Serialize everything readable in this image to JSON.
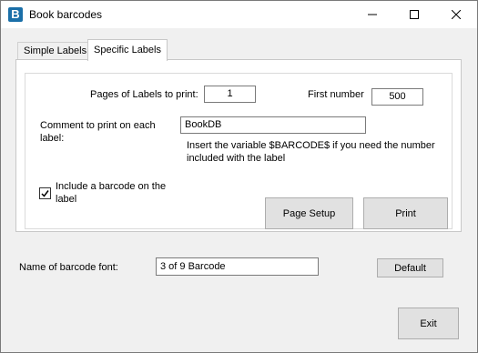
{
  "window": {
    "title": "Book barcodes",
    "app_icon_letter": "B"
  },
  "tabs": [
    {
      "label": "Simple Labels",
      "active": false
    },
    {
      "label": "Specific Labels",
      "active": true
    }
  ],
  "specific": {
    "pages_label": "Pages of Labels to print:",
    "pages_value": "1",
    "first_number_label": "First number",
    "first_number_value": "500",
    "comment_label": "Comment to print on each label:",
    "comment_value": "BookDB",
    "hint": "Insert the variable $BARCODE$ if you need the number included with the label",
    "include_barcode_label": "Include a barcode on the label",
    "include_barcode_checked": true,
    "page_setup_label": "Page Setup",
    "print_label": "Print"
  },
  "font": {
    "label": "Name of barcode font:",
    "value": "3 of 9 Barcode",
    "default_label": "Default"
  },
  "exit_label": "Exit"
}
